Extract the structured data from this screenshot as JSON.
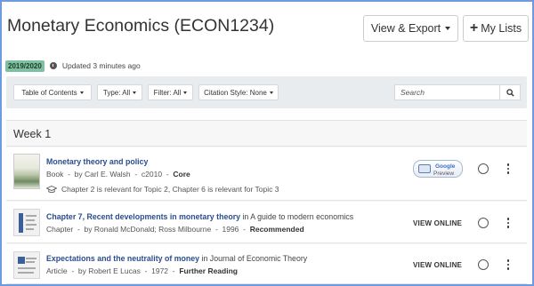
{
  "header": {
    "title": "Monetary Economics (ECON1234)",
    "export_label": "View & Export",
    "lists_label": "My Lists"
  },
  "meta": {
    "year": "2019/2020",
    "updated": "Updated 3 minutes ago"
  },
  "toolbar": {
    "toc": "Table of Contents",
    "type": "Type: All",
    "filter": "Filter: All",
    "citation": "Citation Style: None",
    "search_placeholder": "Search"
  },
  "section": {
    "title": "Week 1"
  },
  "items": [
    {
      "title": "Monetary theory and policy",
      "in_text": "",
      "type": "Book",
      "authors": "by Carl E. Walsh",
      "date": "c2010",
      "importance": "Core",
      "note": "Chapter 2 is relevant for Topic 2, Chapter 6 is relevant for Topic 3",
      "action": "Google Preview"
    },
    {
      "title": "Chapter 7, Recent developments in monetary theory",
      "in_text": " in A guide to modern economics",
      "type": "Chapter",
      "authors": "by Ronald McDonald; Ross Milbourne",
      "date": "1996",
      "importance": "Recommended",
      "action": "VIEW ONLINE"
    },
    {
      "title": "Expectations and the neutrality of money",
      "in_text": " in Journal of Economic Theory",
      "type": "Article",
      "authors": "by Robert E Lucas",
      "date": "1972",
      "importance": "Further Reading",
      "action": "VIEW ONLINE"
    }
  ],
  "google_preview": {
    "brand": "Google",
    "label": "Preview"
  },
  "colors": {
    "accent_link": "#2a4d8f",
    "year_badge": "#7ec1a0",
    "frame_border": "#6d9be0"
  },
  "icons": [
    "clock-icon",
    "search-icon",
    "mortarboard-icon",
    "kebab-icon",
    "radio-icon"
  ]
}
